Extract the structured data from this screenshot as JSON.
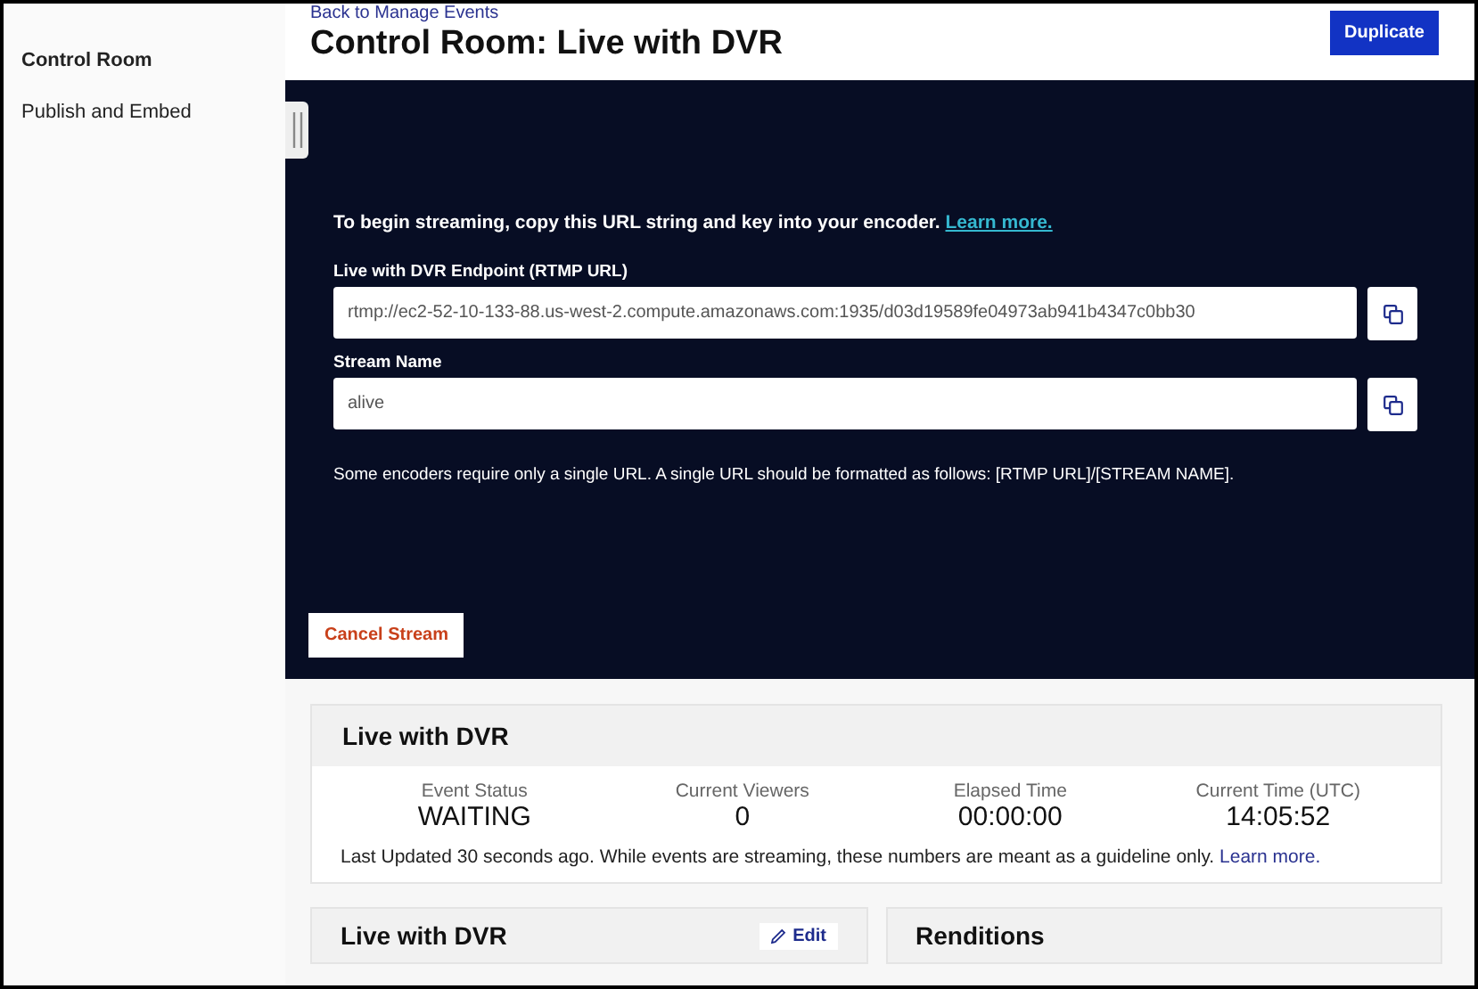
{
  "sidebar": {
    "items": [
      {
        "label": "Control Room",
        "selected": true
      },
      {
        "label": "Publish and Embed",
        "selected": false
      }
    ]
  },
  "header": {
    "back_link": "Back to Manage Events",
    "title": "Control Room: Live with DVR",
    "action": "Duplicate"
  },
  "stream_panel": {
    "intro": "To begin streaming, copy this URL string and key into your encoder.",
    "intro_link": "Learn more.",
    "fields": [
      {
        "label": "Live with DVR Endpoint (RTMP URL)",
        "value": "rtmp://ec2-52-10-133-88.us-west-2.compute.amazonaws.com:1935/d03d19589fe04973ab941b4347c0bb30"
      },
      {
        "label": "Stream Name",
        "value": "alive"
      }
    ],
    "note": "Some encoders require only a single URL. A single URL should be formatted as follows: [RTMP URL]/[STREAM NAME].",
    "cancel_button": "Cancel Stream"
  },
  "stats_card": {
    "title": "Live with DVR",
    "stats": [
      {
        "label": "Event Status",
        "value": "WAITING"
      },
      {
        "label": "Current Viewers",
        "value": "0"
      },
      {
        "label": "Elapsed Time",
        "value": "00:00:00"
      },
      {
        "label": "Current Time (UTC)",
        "value": "14:05:52"
      }
    ],
    "footnote": "Last Updated 30 seconds ago. While events are streaming, these numbers are meant as a guideline only.",
    "footnote_link": "Learn more."
  },
  "bottom_cards": [
    {
      "title": "Live with DVR",
      "action": "Edit"
    },
    {
      "title": "Renditions"
    }
  ]
}
